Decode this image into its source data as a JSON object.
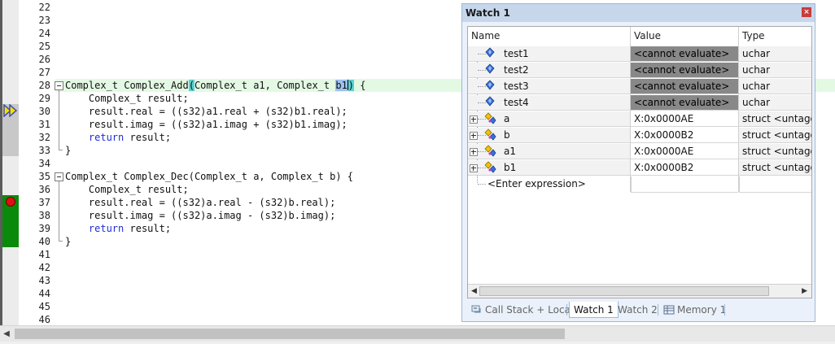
{
  "editor": {
    "lines": [
      {
        "num": "22",
        "code": ""
      },
      {
        "num": "23",
        "code": ""
      },
      {
        "num": "24",
        "code": ""
      },
      {
        "num": "25",
        "code": ""
      },
      {
        "num": "26",
        "code": ""
      },
      {
        "num": "27",
        "code": ""
      },
      {
        "num": "28",
        "code": ""
      },
      {
        "num": "29",
        "code": "    Complex_t result;"
      },
      {
        "num": "30",
        "code": "    result.real = ((s32)a1.real + (s32)b1.real);"
      },
      {
        "num": "31",
        "code": "    result.imag = ((s32)a1.imag + (s32)b1.imag);"
      },
      {
        "num": "32",
        "code": ""
      },
      {
        "num": "33",
        "code": "}"
      },
      {
        "num": "34",
        "code": ""
      },
      {
        "num": "35",
        "code": "Complex_t Complex_Dec(Complex_t a, Complex_t b) {"
      },
      {
        "num": "36",
        "code": "    Complex_t result;"
      },
      {
        "num": "37",
        "code": "    result.real = ((s32)a.real - (s32)b.real);"
      },
      {
        "num": "38",
        "code": "    result.imag = ((s32)a.imag - (s32)b.imag);"
      },
      {
        "num": "39",
        "code": ""
      },
      {
        "num": "40",
        "code": "}"
      },
      {
        "num": "41",
        "code": ""
      },
      {
        "num": "42",
        "code": ""
      },
      {
        "num": "43",
        "code": ""
      },
      {
        "num": "44",
        "code": ""
      },
      {
        "num": "45",
        "code": ""
      },
      {
        "num": "46",
        "code": ""
      }
    ],
    "line28": {
      "pre": "Complex_t Complex_Add",
      "open": "(",
      "mid": "Complex_t a1, Complex_t ",
      "sel": "b1",
      "close": ")",
      "post": " {"
    },
    "return_kw": "return",
    "return_rest": " result;"
  },
  "watch": {
    "title": "Watch 1",
    "close_glyph": "×",
    "columns": {
      "name": "Name",
      "value": "Value",
      "type": "Type"
    },
    "rows": [
      {
        "name": "test1",
        "value": "<cannot evaluate>",
        "type": "uchar"
      },
      {
        "name": "test2",
        "value": "<cannot evaluate>",
        "type": "uchar"
      },
      {
        "name": "test3",
        "value": "<cannot evaluate>",
        "type": "uchar"
      },
      {
        "name": "test4",
        "value": "<cannot evaluate>",
        "type": "uchar"
      },
      {
        "name": "a",
        "value": "X:0x0000AE",
        "type": "struct <untagged>"
      },
      {
        "name": "b",
        "value": "X:0x0000B2",
        "type": "struct <untagged>"
      },
      {
        "name": "a1",
        "value": "X:0x0000AE",
        "type": "struct <untagged>"
      },
      {
        "name": "b1",
        "value": "X:0x0000B2",
        "type": "struct <untagged>"
      }
    ],
    "enter_expression": "<Enter expression>",
    "tabs": {
      "call_stack": "Call Stack + Locals",
      "watch1": "Watch 1",
      "watch2": "Watch 2",
      "memory1": "Memory 1"
    }
  },
  "icons": {
    "breakpoint": "breakpoint-icon",
    "current_line": "current-line-arrow-icon",
    "variable": "variable-icon",
    "struct": "struct-icon",
    "call_stack": "call-stack-icon",
    "memory": "memory-icon"
  },
  "colors": {
    "keyword": "#1f2ed6",
    "current_line_bg": "#e4f9e4",
    "breakpoint": "#e01010",
    "coverage_green": "#0a8a0a",
    "cannot_evaluate_bg": "#888888"
  }
}
